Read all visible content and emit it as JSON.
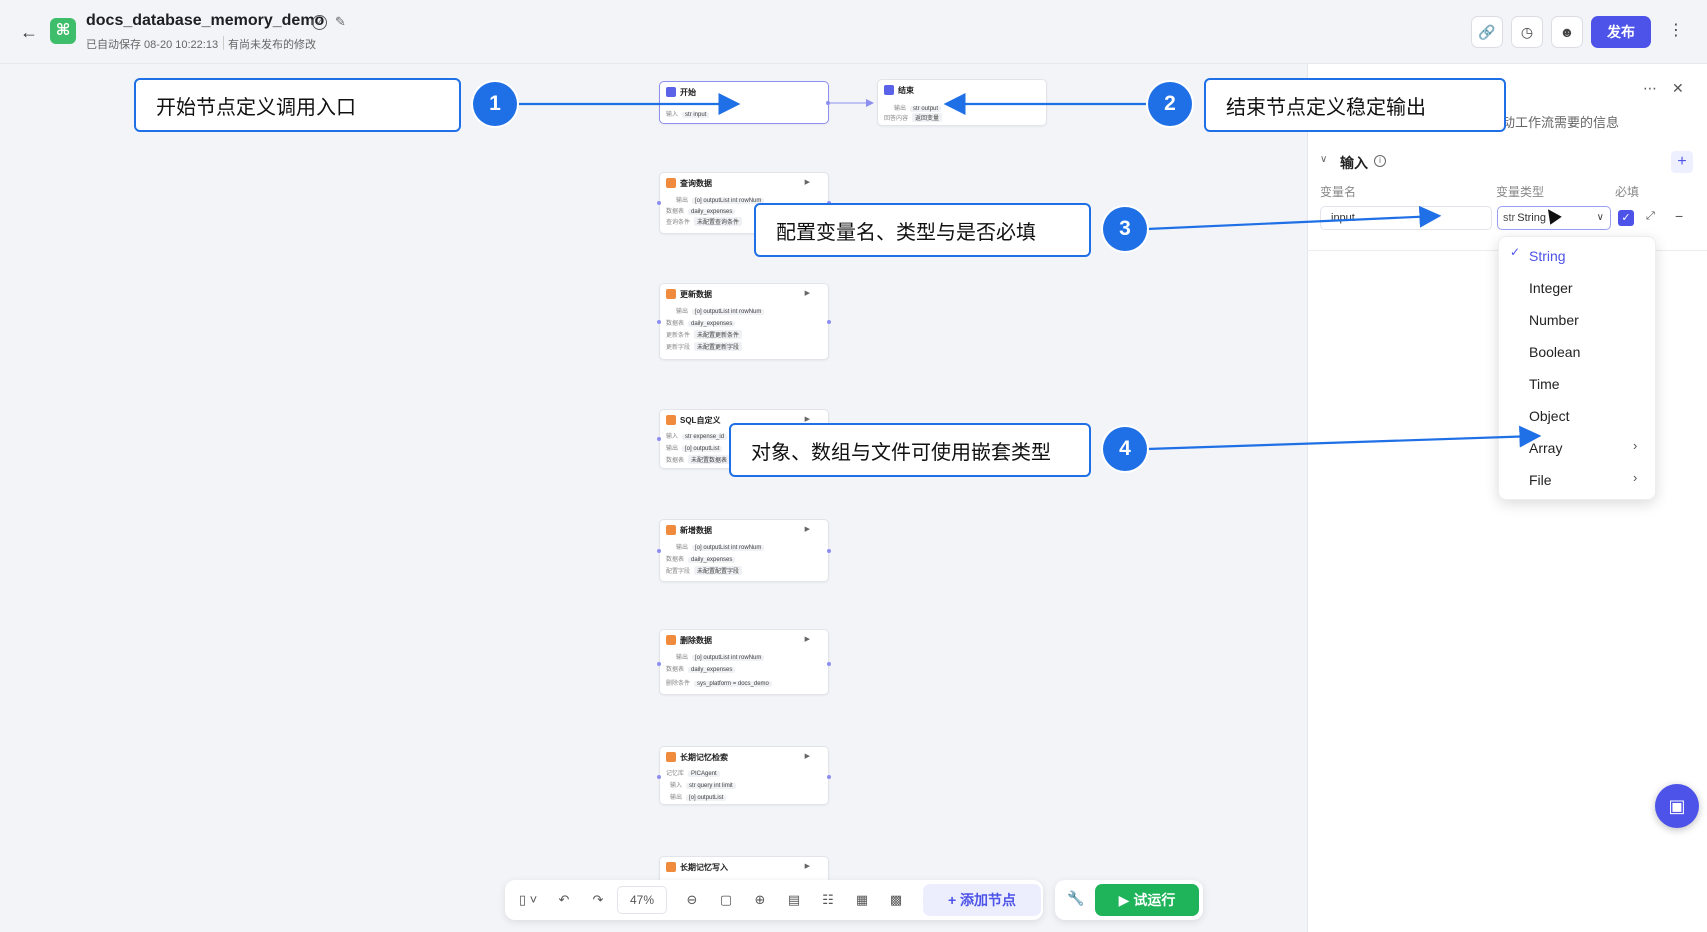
{
  "header": {
    "back_icon": "arrow-left-icon",
    "title": "docs_database_memory_demo",
    "save_info": "已自动保存 08-20 10:22:13",
    "unpublished": "有尚未发布的修改",
    "publish_label": "发布"
  },
  "nodes": {
    "start": {
      "title": "开始",
      "row1_label": "输入",
      "row1_tag": "str input"
    },
    "end": {
      "title": "结束",
      "row1_label": "输出",
      "row1_tag": "str output",
      "row2_label": "回答内容",
      "row2_tag": "返回变量"
    },
    "query": {
      "title": "查询数据",
      "row1_label": "输出",
      "row1_tag": "[o] outputList   int rowNum",
      "row2_label": "数据表",
      "row2_tag": "daily_expenses",
      "row3_label": "查询条件",
      "row3_tag": "未配置查询条件"
    },
    "update": {
      "title": "更新数据",
      "row1_label": "输出",
      "row1_tag": "[o] outputList   int rowNum",
      "row2_label": "数据表",
      "row2_tag": "daily_expenses",
      "row3_label": "更新条件",
      "row3_tag": "未配置更新条件",
      "row4_label": "更新字段",
      "row4_tag": "未配置更新字段"
    },
    "sql": {
      "title": "SQL自定义",
      "row1_label": "输入",
      "row1_tag": "str expense_id",
      "row2_label": "输出",
      "row2_tag": "[o] outputList",
      "row3_label": "数据表",
      "row3_tag": "未配置数据表"
    },
    "insert": {
      "title": "新增数据",
      "row1_label": "输出",
      "row1_tag": "[o] outputList   int rowNum",
      "row2_label": "数据表",
      "row2_tag": "daily_expenses",
      "row3_label": "配置字段",
      "row3_tag": "未配置配置字段"
    },
    "delete": {
      "title": "删除数据",
      "row1_label": "输出",
      "row1_tag": "[o] outputList   int rowNum",
      "row2_label": "数据表",
      "row2_tag": "daily_expenses",
      "row3_label": "删除条件",
      "row3_tag": "sys_platform  =  docs_demo"
    },
    "ltm_search": {
      "title": "长期记忆检索",
      "row1_label": "记忆库",
      "row1_tag": "PICAgent",
      "row2_label": "输入",
      "row2_tag": "str query   int limit",
      "row3_label": "输出",
      "row3_tag": "[o] outputList"
    },
    "ltm_write": {
      "title": "长期记忆写入"
    }
  },
  "panel": {
    "description": "动工作流需要的信息",
    "section_title": "输入",
    "col_name": "变量名",
    "col_type": "变量类型",
    "col_required": "必填",
    "var_name": "input",
    "var_type_prefix": "str",
    "var_type": "String",
    "required": true
  },
  "type_options": [
    "String",
    "Integer",
    "Number",
    "Boolean",
    "Time",
    "Object",
    "Array",
    "File"
  ],
  "toolbar": {
    "zoom": "47%",
    "add_node": "添加节点",
    "test_run": "试运行"
  },
  "callouts": {
    "c1": {
      "num": "1",
      "text": "开始节点定义调用入口"
    },
    "c2": {
      "num": "2",
      "text": "结束节点定义稳定输出"
    },
    "c3": {
      "num": "3",
      "text": "配置变量名、类型与是否必填"
    },
    "c4": {
      "num": "4",
      "text": "对象、数组与文件可使用嵌套类型"
    }
  },
  "colors": {
    "accent": "#4d53e8",
    "callout_blue": "#1f6fe6",
    "run_green": "#1fb35a",
    "node_orange": "#f08a3c"
  }
}
